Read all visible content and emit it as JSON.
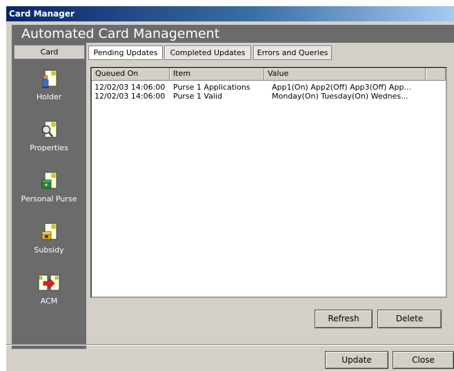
{
  "window": {
    "title": "Card Manager"
  },
  "header": {
    "title": "Automated Card Management"
  },
  "sidebar": {
    "tab_label": "Card",
    "items": [
      {
        "label": "Holder",
        "icon": "holder-icon"
      },
      {
        "label": "Properties",
        "icon": "properties-icon"
      },
      {
        "label": "Personal Purse",
        "icon": "personal-purse-icon"
      },
      {
        "label": "Subsidy",
        "icon": "subsidy-icon"
      },
      {
        "label": "ACM",
        "icon": "acm-icon"
      }
    ]
  },
  "tabs": [
    {
      "label": "Pending Updates",
      "active": true
    },
    {
      "label": "Completed Updates",
      "active": false
    },
    {
      "label": "Errors and Queries",
      "active": false
    }
  ],
  "table": {
    "columns": [
      "Queued On",
      "Item",
      "Value"
    ],
    "rows": [
      [
        "12/02/03 14:06:00",
        "Purse 1 Applications",
        "App1(On) App2(Off) App3(Off) App..."
      ],
      [
        "12/02/03 14:06:00",
        "Purse 1 Valid",
        "Monday(On) Tuesday(On) Wednes..."
      ]
    ]
  },
  "buttons": {
    "refresh": "Refresh",
    "delete": "Delete",
    "update": "Update",
    "close": "Close"
  },
  "colors": {
    "sidebar_bg": "#6b6b6b",
    "window_bg": "#d4d0c8",
    "titlebar": "#0a246a"
  }
}
